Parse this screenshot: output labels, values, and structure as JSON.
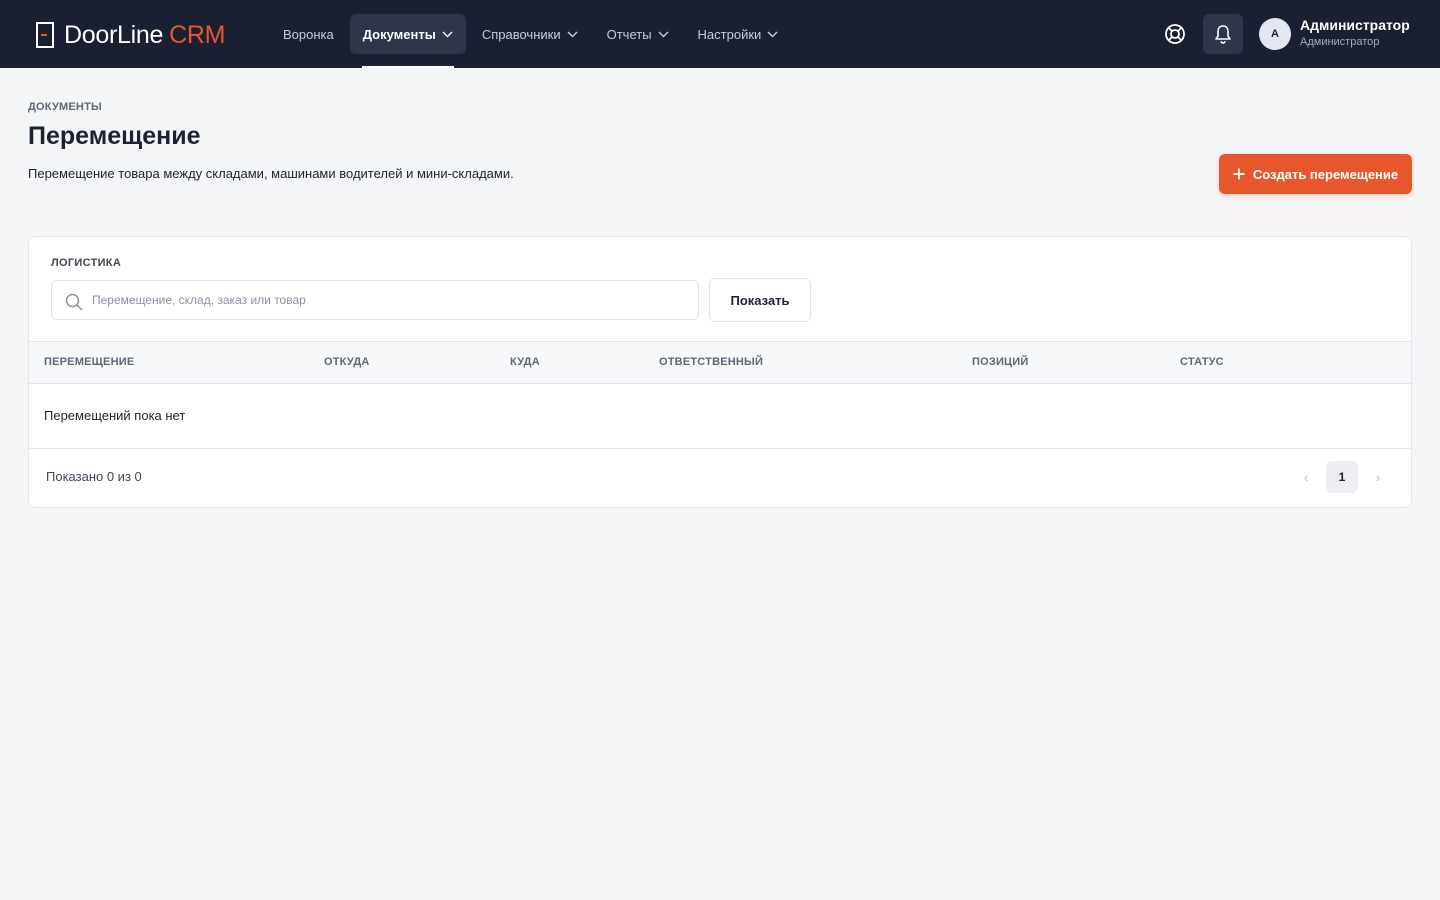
{
  "header": {
    "logo": {
      "main": "DoorLine",
      "accent": "CRM"
    },
    "nav": [
      {
        "label": "Воронка",
        "has_dropdown": false,
        "active": false
      },
      {
        "label": "Документы",
        "has_dropdown": true,
        "active": true
      },
      {
        "label": "Справочники",
        "has_dropdown": true,
        "active": false
      },
      {
        "label": "Отчеты",
        "has_dropdown": true,
        "active": false
      },
      {
        "label": "Настройки",
        "has_dropdown": true,
        "active": false
      }
    ],
    "icons": {
      "help": "lifebuoy-icon",
      "notifications": "bell-icon"
    },
    "user": {
      "avatar_initial": "А",
      "name": "Администратор",
      "role": "Администратор"
    }
  },
  "page": {
    "breadcrumb": "ДОКУМЕНТЫ",
    "title": "Перемещение",
    "description": "Перемещение товара между складами, машинами водителей и мини-складами.",
    "create_button": "Создать перемещение"
  },
  "filters": {
    "section_label": "ЛОГИСТИКА",
    "search_placeholder": "Перемещение, склад, заказ или товар",
    "search_value": "",
    "show_button": "Показать"
  },
  "table": {
    "columns": [
      "ПЕРЕМЕЩЕНИЕ",
      "ОТКУДА",
      "КУДА",
      "ОТВЕТСТВЕННЫЙ",
      "ПОЗИЦИЙ",
      "СТАТУС"
    ],
    "rows": [],
    "empty_message": "Перемещений пока нет"
  },
  "pagination": {
    "summary": "Показано 0 из 0",
    "prev": "‹",
    "current_page": "1",
    "next": "›"
  },
  "colors": {
    "topbar": "#1a1f31",
    "accent": "#e8562e",
    "background": "#f4f5f7"
  }
}
